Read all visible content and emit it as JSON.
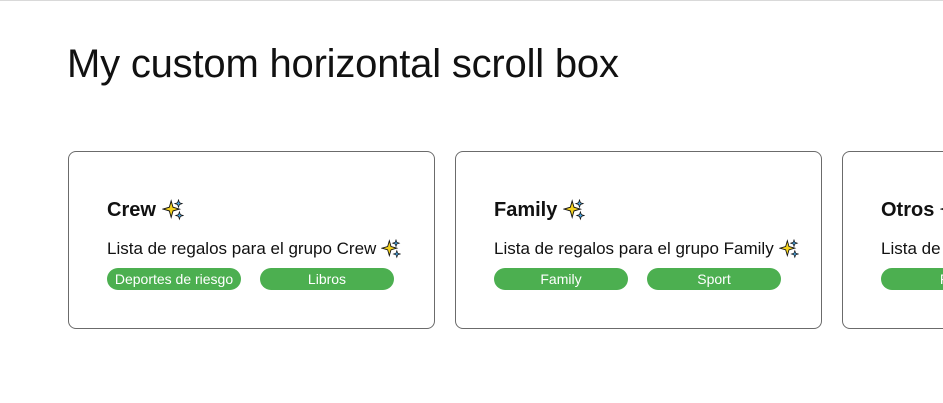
{
  "page": {
    "title": "My custom horizontal scroll box"
  },
  "icons": {
    "sparkles": "sparkles-icon"
  },
  "colors": {
    "tag_background": "#4caf50",
    "tag_text": "#ffffff",
    "card_border": "#6b6b6b",
    "sparkle_primary": "#f4d21f",
    "sparkle_secondary": "#4aa3df"
  },
  "cards": [
    {
      "title": "Crew",
      "description": "Lista de regalos para el grupo Crew",
      "tags": [
        "Deportes de riesgo",
        "Libros"
      ]
    },
    {
      "title": "Family",
      "description": "Lista de regalos para el grupo Family",
      "tags": [
        "Family",
        "Sport"
      ]
    },
    {
      "title": "Otros",
      "description": "Lista de",
      "tags": [
        "Fa"
      ]
    }
  ]
}
